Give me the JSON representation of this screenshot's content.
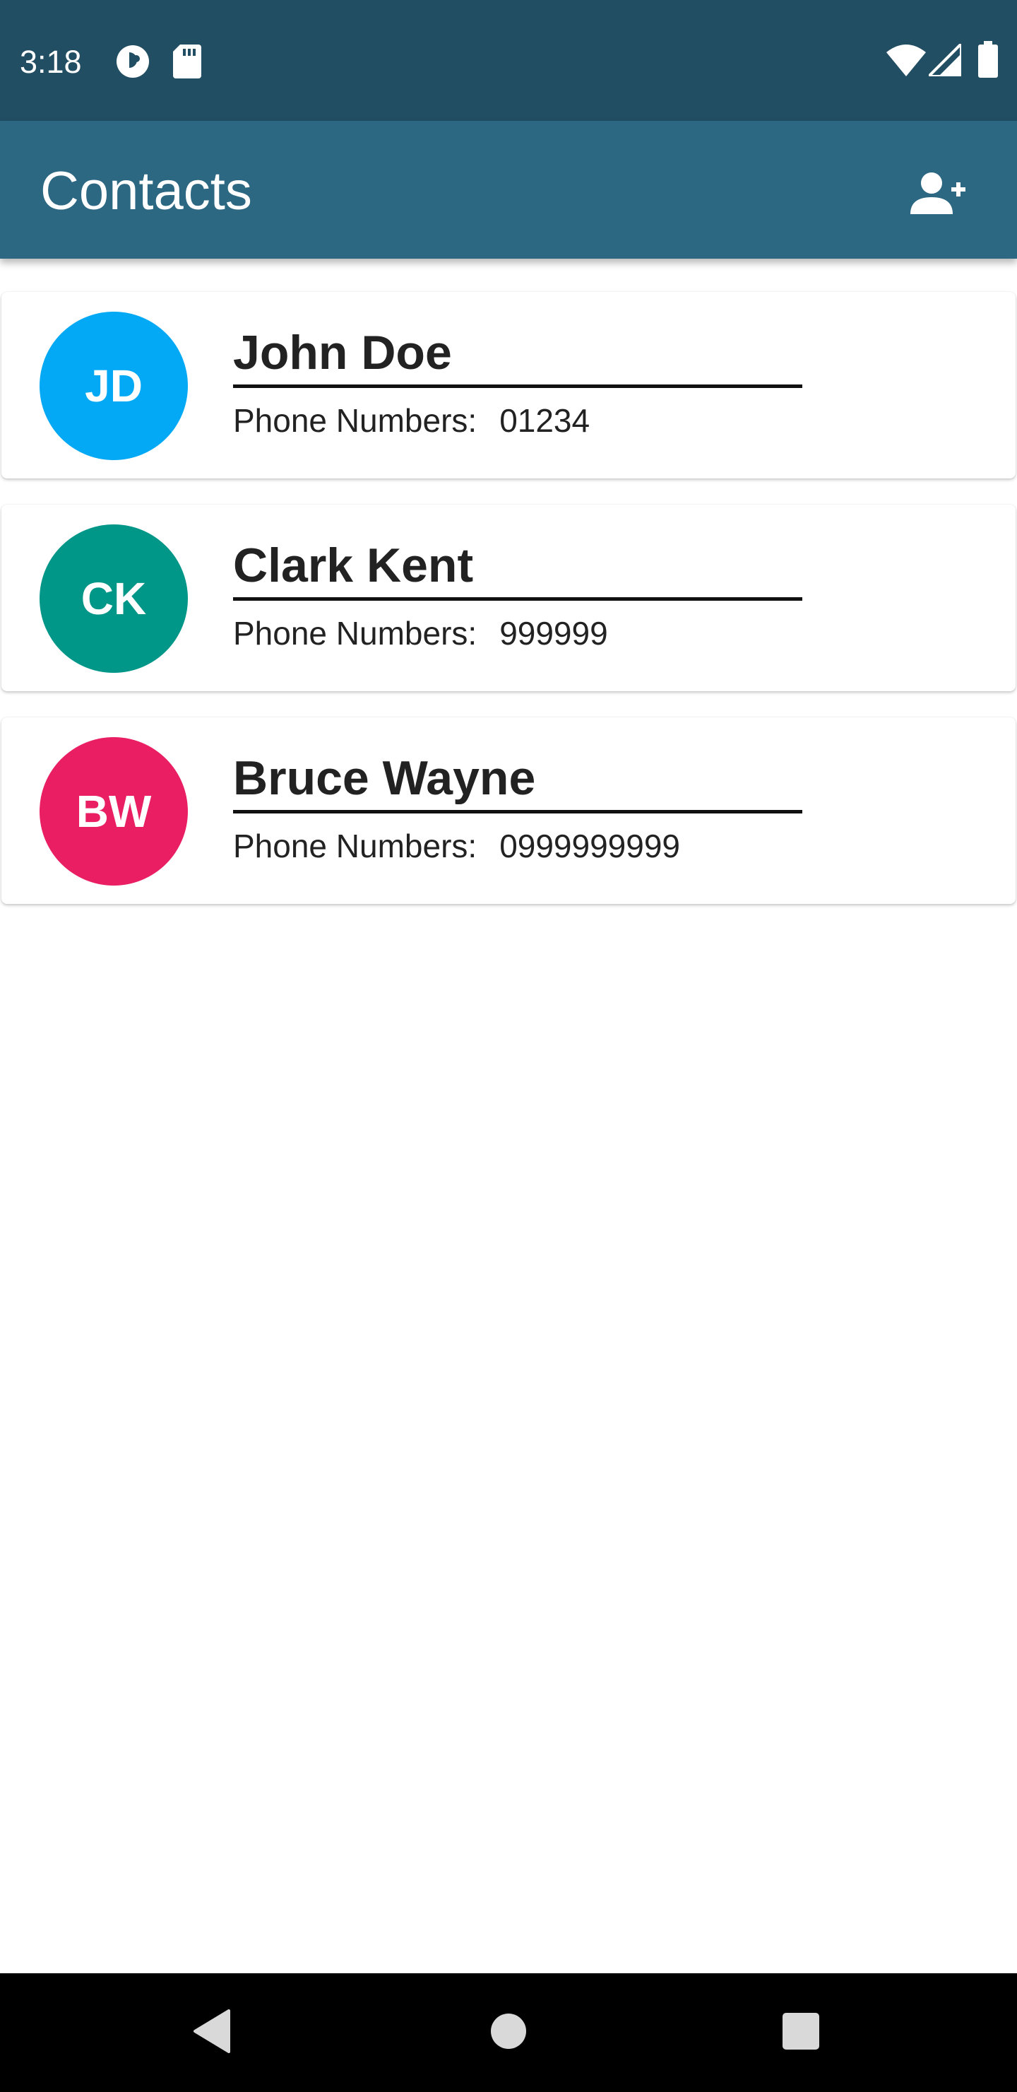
{
  "status_bar": {
    "time": "3:18",
    "left_icons": [
      "app-notification-icon",
      "sd-card-icon"
    ],
    "right_icons": [
      "wifi-icon",
      "cell-signal-icon",
      "battery-icon"
    ]
  },
  "app_bar": {
    "title": "Contacts",
    "action_icon": "add-person-icon"
  },
  "contacts": [
    {
      "initials": "JD",
      "name": "John Doe",
      "phone_label": "Phone Numbers:",
      "phone": "01234",
      "avatar_color": "#03a9f4"
    },
    {
      "initials": "CK",
      "name": "Clark Kent",
      "phone_label": "Phone Numbers:",
      "phone": "999999",
      "avatar_color": "#009688"
    },
    {
      "initials": "BW",
      "name": "Bruce Wayne",
      "phone_label": "Phone Numbers:",
      "phone": "0999999999",
      "avatar_color": "#e91e63"
    }
  ],
  "nav_bar": {
    "buttons": [
      "back-icon",
      "home-icon",
      "recents-icon"
    ]
  },
  "colors": {
    "status_bar": "#214e63",
    "app_bar": "#2d6883",
    "nav_bar": "#000000"
  }
}
